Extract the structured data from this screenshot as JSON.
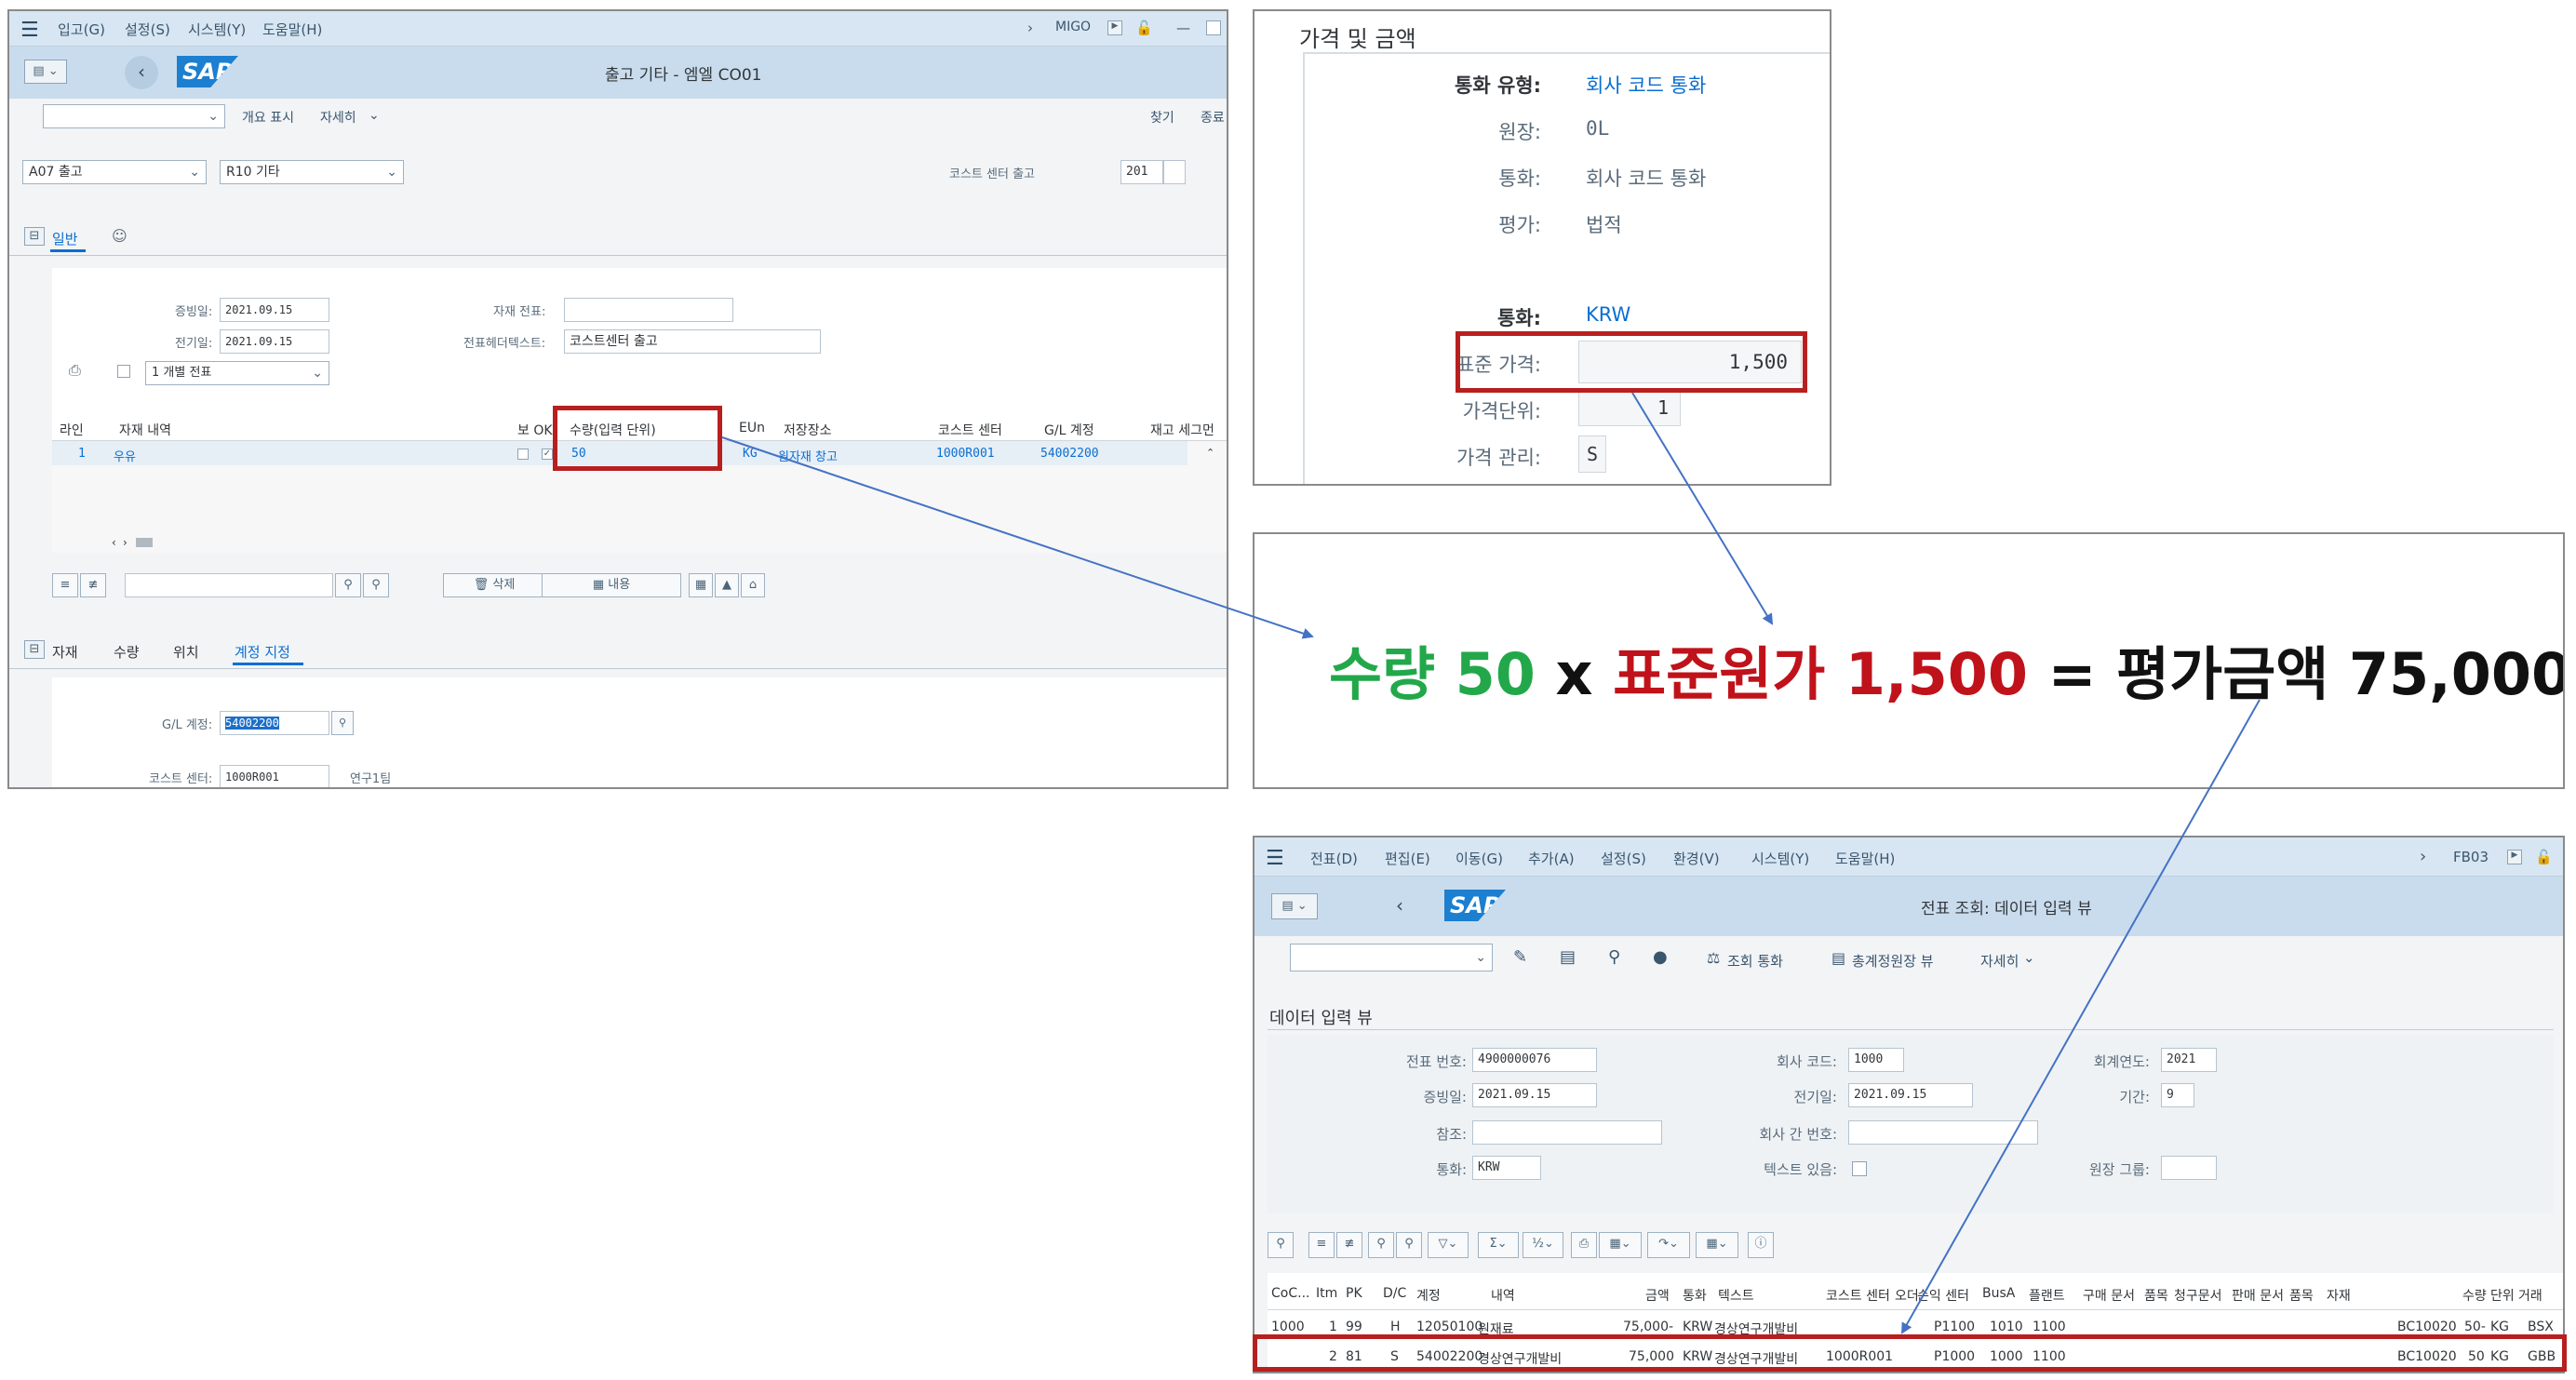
{
  "migo": {
    "menu": [
      "입고(G)",
      "설정(S)",
      "시스템(Y)",
      "도움말(H)"
    ],
    "tcode": "MIGO",
    "title": "출고 기타 - 엠엘 CO01",
    "toolbar": {
      "overview": "개요 표시",
      "detail": "자세히",
      "find": "찾기",
      "end": "종료"
    },
    "action_select": "A07 출고",
    "reason_select": "R10 기타",
    "cost_center_issue_label": "코스트 센터 출고",
    "movement_type": "201",
    "tabs": [
      "일반"
    ],
    "doc_date_label": "증빙일:",
    "doc_date": "2021.09.15",
    "post_date_label": "전기일:",
    "post_date": "2021.09.15",
    "mat_doc_label": "자재 전표:",
    "header_text_label": "전표헤더텍스트:",
    "header_text": "코스트센터 출고",
    "print_select": "1 개별 전표",
    "table_headers": [
      "라인",
      "자재 내역",
      "보 OK",
      "수량(입력 단위)",
      "EUn",
      "저장장소",
      "코스트 센터",
      "G/L 계정",
      "재고 세그먼"
    ],
    "row": {
      "line": "1",
      "material": "우유",
      "qty": "50",
      "unit": "KG",
      "storage": "원자재 창고",
      "cost_center": "1000R001",
      "gl": "54002200"
    },
    "buttons": {
      "delete": "삭제",
      "contents": "내용"
    },
    "detail_tabs": [
      "자재",
      "수량",
      "위치",
      "계정 지정"
    ],
    "gl_label": "G/L 계정:",
    "gl_value": "54002200",
    "cc_label": "코스트 센터:",
    "cc_value": "1000R001",
    "cc_desc": "연구1팀"
  },
  "price": {
    "title": "가격 및 금액",
    "fields": [
      {
        "label": "통화 유형:",
        "value": "회사 코드 통화",
        "link": true
      },
      {
        "label": "원장:",
        "value": "0L",
        "link": false
      },
      {
        "label": "통화:",
        "value": "회사 코드 통화",
        "link": false
      },
      {
        "label": "평가:",
        "value": "법적",
        "link": false
      }
    ],
    "currency_label": "통화:",
    "currency": "KRW",
    "std_price_label": "표준 가격:",
    "std_price": "1,500",
    "price_unit_label": "가격단위:",
    "price_unit": "1",
    "price_control_label": "가격 관리:",
    "price_control": "S"
  },
  "formula": {
    "qty_label": "수량 ",
    "qty": "50",
    "times": " x ",
    "price_label": "표준원가 ",
    "price": "1,500",
    "eq": " = ",
    "result_label": "평가금액 ",
    "result": "75,000",
    "colors": {
      "qty": "#22a84a",
      "price": "#c0121a",
      "result": "#111111"
    }
  },
  "fb03": {
    "menu": [
      "전표(D)",
      "편집(E)",
      "이동(G)",
      "추가(A)",
      "설정(S)",
      "환경(V)",
      "시스템(Y)",
      "도움말(H)"
    ],
    "tcode": "FB03",
    "title": "전표 조회: 데이터 입력 뷰",
    "toolbar": {
      "display_currency": "조회 통화",
      "gl_view": "총계정원장 뷰",
      "detail": "자세히"
    },
    "section_title": "데이터 입력 뷰",
    "doc_no_label": "전표 번호:",
    "doc_no": "4900000076",
    "company_label": "회사 코드:",
    "company": "1000",
    "fiscal_year_label": "회계연도:",
    "fiscal_year": "2021",
    "doc_date_label": "증빙일:",
    "doc_date": "2021.09.15",
    "post_date_label": "전기일:",
    "post_date": "2021.09.15",
    "period_label": "기간:",
    "period": "9",
    "ref_label": "참조:",
    "intercompany_label": "회사 간 번호:",
    "currency_label": "통화:",
    "currency": "KRW",
    "text_exists_label": "텍스트 있음:",
    "ledger_group_label": "원장 그룹:",
    "headers": [
      "CoC...",
      "Itm",
      "PK",
      "D/C",
      "계정",
      "내역",
      "금액",
      "통화",
      "텍스트",
      "코스트 센터",
      "오더",
      "손익 센터",
      "BusA",
      "플랜트",
      "구매 문서",
      "품목",
      "청구문서",
      "판매 문서",
      "품목",
      "자재",
      "수량",
      "단위",
      "거래"
    ],
    "rows": [
      {
        "coc": "1000",
        "itm": "1",
        "pk": "99",
        "dc": "H",
        "acct": "12050100",
        "desc": "원재료",
        "amt": "75,000-",
        "cur": "KRW",
        "text": "경상연구개발비",
        "cc": "",
        "pc": "P1100",
        "busa": "1010",
        "plant": "1100",
        "mat": "BC10020",
        "qty": "50-",
        "unit": "KG",
        "tt": "BSX"
      },
      {
        "coc": "",
        "itm": "2",
        "pk": "81",
        "dc": "S",
        "acct": "54002200",
        "desc": "경상연구개발비",
        "amt": "75,000",
        "cur": "KRW",
        "text": "경상연구개발비",
        "cc": "1000R001",
        "pc": "P1000",
        "busa": "1000",
        "plant": "1100",
        "mat": "BC10020",
        "qty": "50",
        "unit": "KG",
        "tt": "GBB"
      }
    ]
  }
}
